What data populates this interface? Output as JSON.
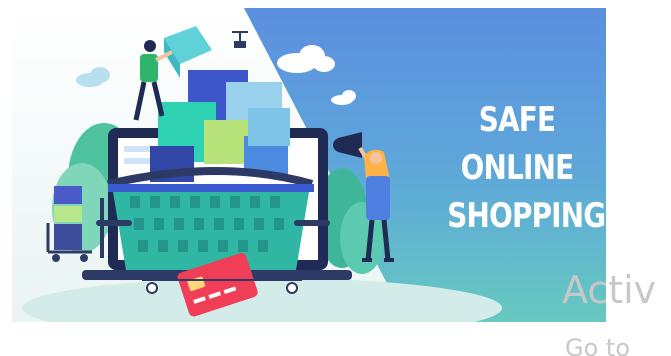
{
  "banner": {
    "headline_lines": [
      "SAFE",
      "ONLINE",
      "SHOPPING"
    ],
    "illustration_icons": [
      "shopping-basket-icon",
      "laptop-icon",
      "boxes-icon",
      "credit-card-icon",
      "megaphone-icon",
      "person-carrying-box-icon",
      "woman-with-megaphone-icon",
      "drone-icon",
      "cloud-icon",
      "tree-icon"
    ],
    "colors": {
      "gradient_top": "#5b8fe0",
      "gradient_bottom": "#62c6c2",
      "basket": "#2fb7a4",
      "credit_card": "#ef3e55",
      "headline_text": "#ffffff"
    }
  },
  "windows_watermark": {
    "title": "Activ",
    "subtitle": "Go to"
  }
}
